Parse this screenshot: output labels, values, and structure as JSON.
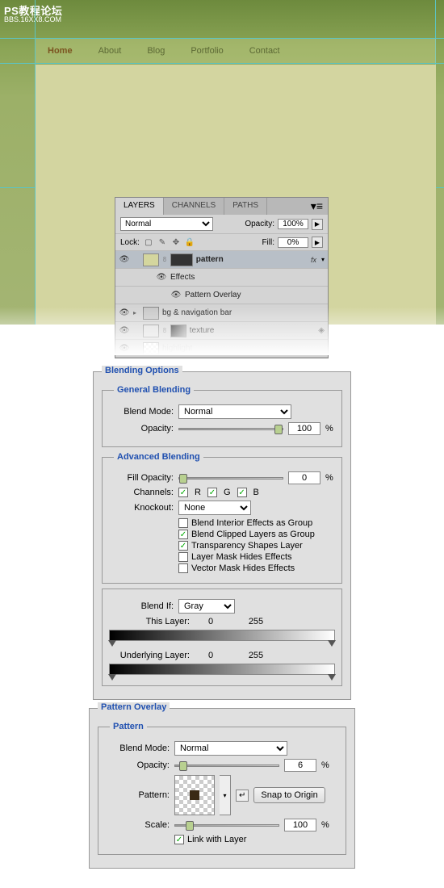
{
  "watermark": {
    "title": "PS教程论坛",
    "sub": "BBS.16XX8.COM"
  },
  "nav": {
    "items": [
      "Home",
      "About",
      "Blog",
      "Portfolio",
      "Contact"
    ],
    "active": 0
  },
  "layers_panel": {
    "tabs": [
      "LAYERS",
      "CHANNELS",
      "PATHS"
    ],
    "blend_mode": "Normal",
    "opacity_label": "Opacity:",
    "opacity_value": "100%",
    "lock_label": "Lock:",
    "fill_label": "Fill:",
    "fill_value": "0%",
    "layers": [
      {
        "name": "pattern",
        "fx": "fx",
        "bold": true
      },
      {
        "name": "Effects"
      },
      {
        "name": "Pattern Overlay"
      },
      {
        "name": "bg & navigation bar"
      },
      {
        "name": "texture"
      },
      {
        "name": "highlight"
      }
    ]
  },
  "blending_options": {
    "title": "Blending Options",
    "general": {
      "title": "General Blending",
      "blend_mode_label": "Blend Mode:",
      "blend_mode": "Normal",
      "opacity_label": "Opacity:",
      "opacity": "100"
    },
    "advanced": {
      "title": "Advanced Blending",
      "fill_opacity_label": "Fill Opacity:",
      "fill_opacity": "0",
      "channels_label": "Channels:",
      "r": "R",
      "g": "G",
      "b": "B",
      "knockout_label": "Knockout:",
      "knockout": "None",
      "cb1": "Blend Interior Effects as Group",
      "cb2": "Blend Clipped Layers as Group",
      "cb3": "Transparency Shapes Layer",
      "cb4": "Layer Mask Hides Effects",
      "cb5": "Vector Mask Hides Effects"
    },
    "blend_if": {
      "label": "Blend If:",
      "value": "Gray",
      "this_layer": "This Layer:",
      "underlying": "Underlying Layer:",
      "low": "0",
      "high": "255"
    }
  },
  "pattern_overlay": {
    "title": "Pattern Overlay",
    "section": "Pattern",
    "blend_mode_label": "Blend Mode:",
    "blend_mode": "Normal",
    "opacity_label": "Opacity:",
    "opacity": "6",
    "pattern_label": "Pattern:",
    "snap": "Snap to Origin",
    "scale_label": "Scale:",
    "scale": "100",
    "link": "Link with Layer"
  }
}
